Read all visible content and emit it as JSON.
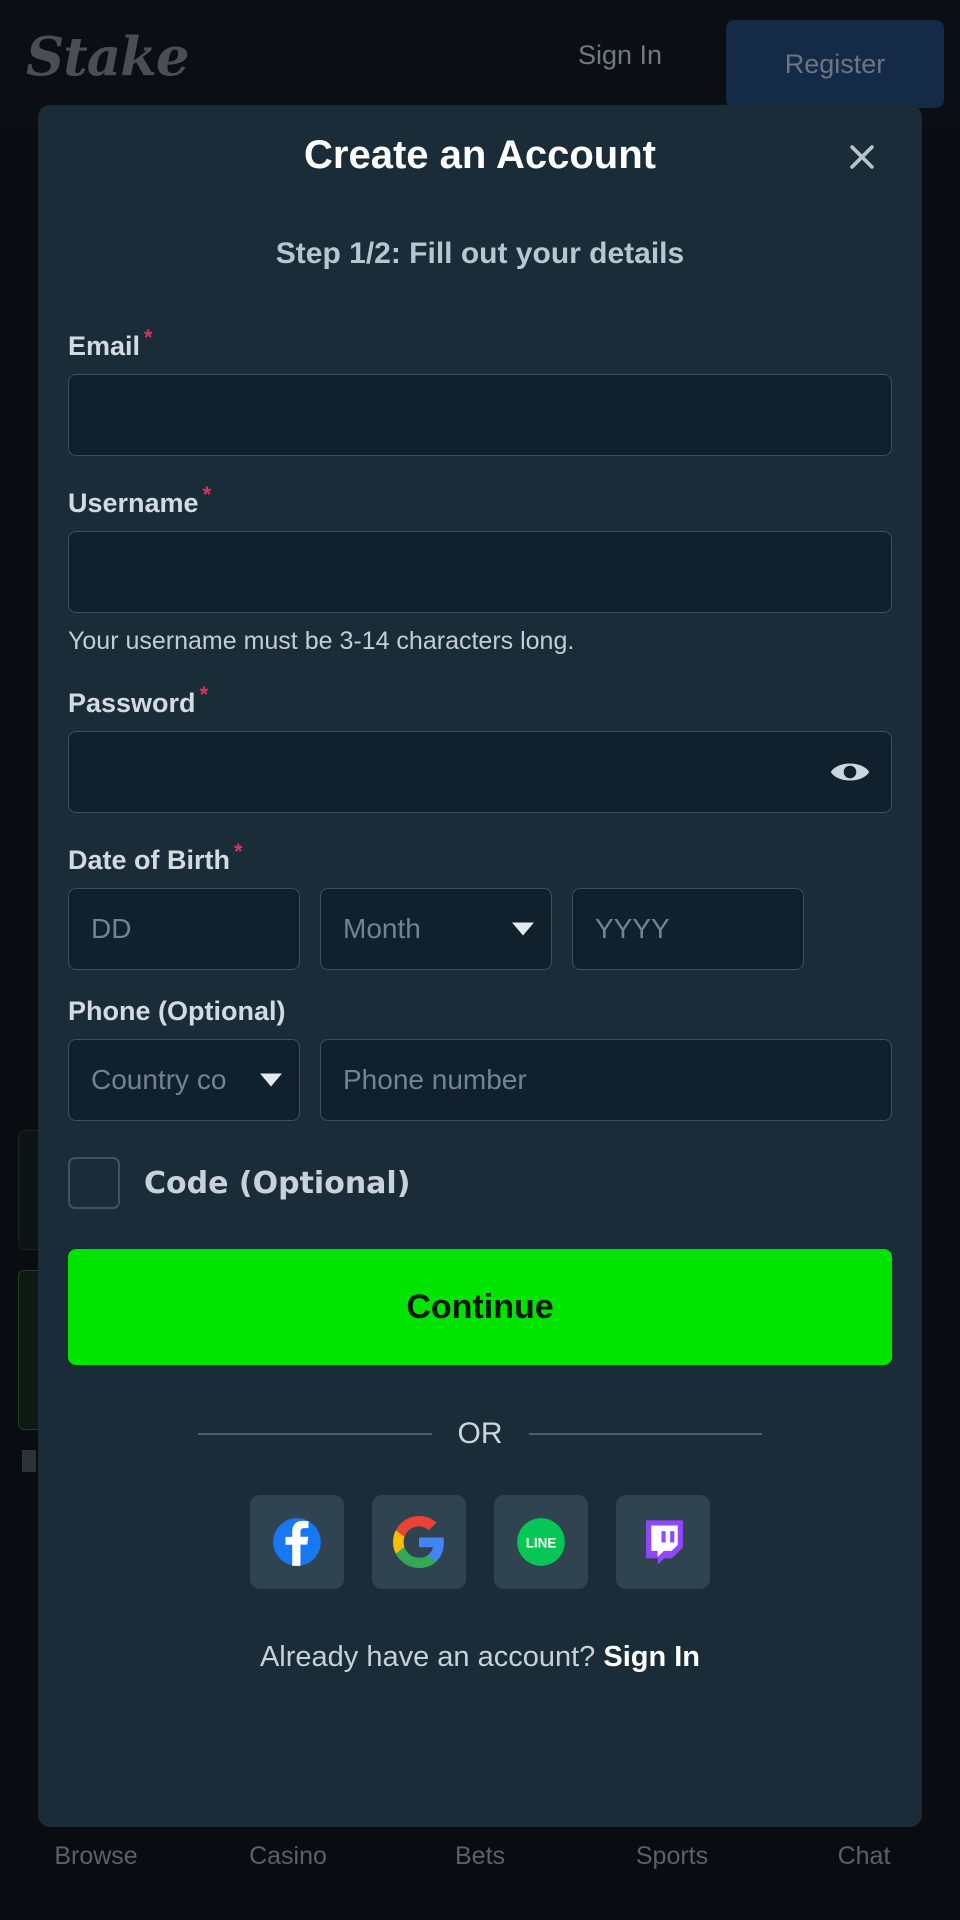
{
  "header": {
    "brand": "Stake",
    "sign_in_label": "Sign In",
    "register_label": "Register"
  },
  "modal": {
    "title": "Create an Account",
    "step_text": "Step 1/2: Fill out your details",
    "close_icon": "close-icon",
    "fields": {
      "email": {
        "label": "Email",
        "required_mark": "*",
        "value": "",
        "placeholder": ""
      },
      "username": {
        "label": "Username",
        "required_mark": "*",
        "value": "",
        "placeholder": "",
        "hint": "Your username must be 3-14 characters long."
      },
      "password": {
        "label": "Password",
        "required_mark": "*",
        "value": "",
        "placeholder": "",
        "toggle_icon": "eye-icon"
      },
      "dob": {
        "label": "Date of Birth",
        "required_mark": "*",
        "day_placeholder": "DD",
        "month_selected": "Month",
        "year_placeholder": "YYYY"
      },
      "phone": {
        "label": "Phone (Optional)",
        "country_code_selected": "Country co",
        "number_placeholder": "Phone number"
      },
      "code": {
        "label": "Code (Optional)",
        "checked": false
      }
    },
    "continue_label": "Continue",
    "or_label": "OR",
    "social": [
      {
        "name": "facebook",
        "label": "Facebook"
      },
      {
        "name": "google",
        "label": "Google"
      },
      {
        "name": "line",
        "label": "LINE"
      },
      {
        "name": "twitch",
        "label": "Twitch"
      }
    ],
    "footer_prompt": "Already have an account?",
    "footer_link": "Sign In"
  },
  "bottom_nav": [
    {
      "label": "Browse",
      "icon": "browse-icon"
    },
    {
      "label": "Casino",
      "icon": "casino-icon"
    },
    {
      "label": "Bets",
      "icon": "bets-icon"
    },
    {
      "label": "Sports",
      "icon": "sports-icon"
    },
    {
      "label": "Chat",
      "icon": "chat-icon"
    }
  ],
  "colors": {
    "accent_green": "#00e400",
    "modal_bg": "#1a2c38",
    "input_bg": "#10202c",
    "required_red": "#e0315b"
  }
}
